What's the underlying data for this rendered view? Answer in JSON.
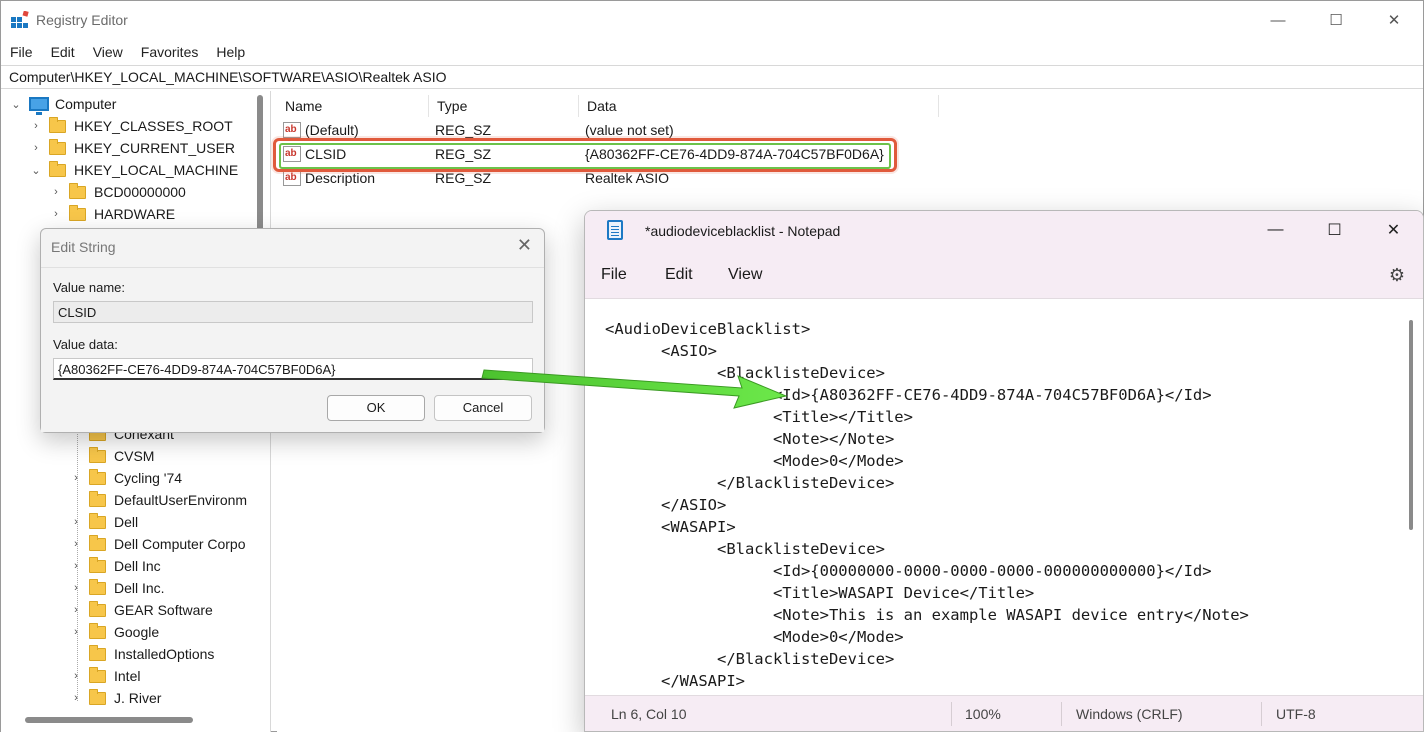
{
  "registry": {
    "title": "Registry Editor",
    "controls": {
      "minimize": "—",
      "maximize": "☐",
      "close": "✕"
    },
    "menu": [
      "File",
      "Edit",
      "View",
      "Favorites",
      "Help"
    ],
    "address": "Computer\\HKEY_LOCAL_MACHINE\\SOFTWARE\\ASIO\\Realtek ASIO",
    "tree": {
      "root": "Computer",
      "hives": [
        "HKEY_CLASSES_ROOT",
        "HKEY_CURRENT_USER",
        "HKEY_LOCAL_MACHINE"
      ],
      "hklm_children": [
        "BCD00000000",
        "HARDWARE"
      ],
      "software_children": [
        "Conexant",
        "CVSM",
        "Cycling '74",
        "DefaultUserEnvironm",
        "Dell",
        "Dell Computer Corpo",
        "Dell Inc",
        "Dell Inc.",
        "GEAR Software",
        "Google",
        "InstalledOptions",
        "Intel",
        "J. River"
      ]
    },
    "columns": {
      "name": "Name",
      "type": "Type",
      "data": "Data"
    },
    "values": [
      {
        "name": "(Default)",
        "type": "REG_SZ",
        "data": "(value not set)"
      },
      {
        "name": "CLSID",
        "type": "REG_SZ",
        "data": "{A80362FF-CE76-4DD9-874A-704C57BF0D6A}"
      },
      {
        "name": "Description",
        "type": "REG_SZ",
        "data": "Realtek ASIO"
      }
    ],
    "value_icon_text": "ab"
  },
  "dialog": {
    "title": "Edit String",
    "close": "✕",
    "value_name_label": "Value name:",
    "value_name": "CLSID",
    "value_data_label": "Value data:",
    "value_data": "{A80362FF-CE76-4DD9-874A-704C57BF0D6A}",
    "ok": "OK",
    "cancel": "Cancel"
  },
  "notepad": {
    "title": "*audiodeviceblacklist - Notepad",
    "controls": {
      "minimize": "—",
      "maximize": "☐",
      "close": "✕"
    },
    "menu": [
      "File",
      "Edit",
      "View"
    ],
    "lines": [
      "<AudioDeviceBlacklist>",
      "      <ASIO>",
      "            <BlacklisteDevice>",
      "                  <Id>{A80362FF-CE76-4DD9-874A-704C57BF0D6A}</Id>",
      "                  <Title></Title>",
      "                  <Note></Note>",
      "                  <Mode>0</Mode>",
      "            </BlacklisteDevice>",
      "      </ASIO>",
      "      <WASAPI>",
      "            <BlacklisteDevice>",
      "                  <Id>{00000000-0000-0000-0000-000000000000}</Id>",
      "                  <Title>WASAPI Device</Title>",
      "                  <Note>This is an example WASAPI device entry</Note>",
      "                  <Mode>0</Mode>",
      "            </BlacklisteDevice>",
      "      </WASAPI>"
    ],
    "status": {
      "position": "Ln 6, Col 10",
      "zoom": "100%",
      "line_ending": "Windows (CRLF)",
      "encoding": "UTF-8"
    }
  },
  "colors": {
    "highlight_outer": "#e05a3c",
    "highlight_inner": "#6cc24a",
    "arrow": "#5fd13c",
    "folder": "#f7c64a"
  }
}
